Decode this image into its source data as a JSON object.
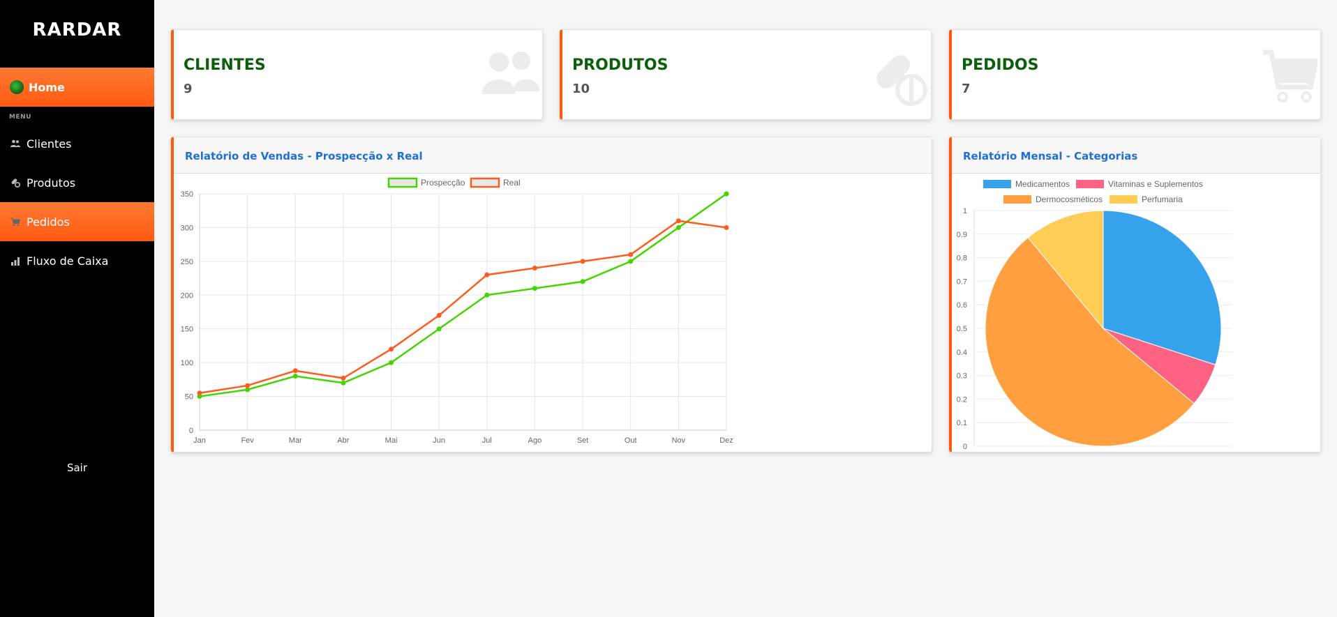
{
  "sidebar": {
    "logo": "RARDAR",
    "home_label": "Home",
    "menu_label": "MENU",
    "items": [
      {
        "label": "Clientes",
        "icon": "users-icon"
      },
      {
        "label": "Produtos",
        "icon": "pills-icon"
      },
      {
        "label": "Pedidos",
        "icon": "cart-icon"
      },
      {
        "label": "Fluxo de Caixa",
        "icon": "bar-chart-icon"
      }
    ],
    "logout_label": "Sair",
    "accent_color": "#ff5a10"
  },
  "stats": [
    {
      "title": "CLIENTES",
      "value": "9",
      "icon": "users-icon"
    },
    {
      "title": "PRODUTOS",
      "value": "10",
      "icon": "pills-icon"
    },
    {
      "title": "PEDIDOS",
      "value": "7",
      "icon": "cart-icon"
    }
  ],
  "panels": {
    "sales_title": "Relatório de Vendas - Prospecção x Real",
    "categories_title": "Relatório Mensal - Categorias"
  },
  "chart_data": [
    {
      "type": "line",
      "categories": [
        "Jan",
        "Fev",
        "Mar",
        "Abr",
        "Mai",
        "Jun",
        "Jul",
        "Ago",
        "Set",
        "Out",
        "Nov",
        "Dez"
      ],
      "series": [
        {
          "name": "Prospecção",
          "color": "#44d400",
          "values": [
            50,
            60,
            80,
            70,
            100,
            150,
            200,
            210,
            220,
            250,
            300,
            350
          ]
        },
        {
          "name": "Real",
          "color": "#ff5a1f",
          "values": [
            55,
            66,
            88,
            77,
            120,
            170,
            230,
            240,
            250,
            260,
            310,
            300
          ]
        }
      ],
      "ylim": [
        0,
        350
      ],
      "yticks": [
        0,
        50,
        100,
        150,
        200,
        250,
        300,
        350
      ],
      "grid": true,
      "legend": "top"
    },
    {
      "type": "pie",
      "labels": [
        "Medicamentos",
        "Vitaminas e Suplementos",
        "Dermocosméticos",
        "Perfumaria"
      ],
      "values": [
        30,
        6,
        53,
        11
      ],
      "colors": [
        "#36a2eb",
        "#ff6384",
        "#ff9f40",
        "#ffcd56"
      ],
      "yticks": [
        "0",
        "0.1",
        "0.2",
        "0.3",
        "0.4",
        "0.5",
        "0.6",
        "0.7",
        "0.8",
        "0.9",
        "1"
      ],
      "grid": true,
      "legend": "top"
    }
  ]
}
